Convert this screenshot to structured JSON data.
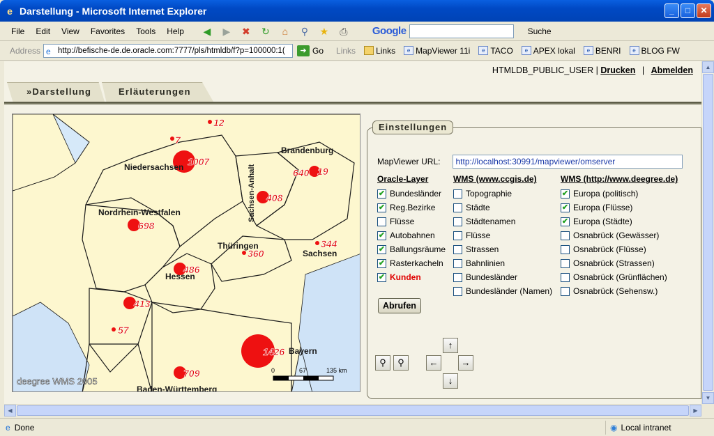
{
  "window": {
    "title": "Darstellung - Microsoft Internet Explorer"
  },
  "menu": [
    "File",
    "Edit",
    "View",
    "Favorites",
    "Tools",
    "Help"
  ],
  "google": {
    "logo": "Google",
    "search_label": "Suche"
  },
  "address": {
    "label": "Address",
    "url": "http://befische-de.de.oracle.com:7777/pls/htmldb/f?p=100000:1(",
    "go": "Go"
  },
  "links": {
    "label": "Links",
    "items": [
      "Links",
      "MapViewer 11i",
      "TACO",
      "APEX lokal",
      "BENRI",
      "BLOG FW"
    ]
  },
  "header": {
    "user": "HTMLDB_PUBLIC_USER |",
    "print": "Drucken",
    "separator": "|",
    "logout": "Abmelden"
  },
  "tabs": [
    "»Darstellung",
    "Erläuterungen"
  ],
  "map": {
    "states": [
      "Niedersachsen",
      "Brandenburg",
      "Sachsen-Anhalt",
      "Nordrhein-Westfalen",
      "Thüringen",
      "Sachsen",
      "Hessen",
      "Bayern",
      "Baden-Württemberg"
    ],
    "counts": [
      "7",
      "12",
      "1007",
      "640",
      "19",
      "408",
      "698",
      "344",
      "360",
      "486",
      "413",
      "57",
      "1426",
      "709"
    ],
    "scale": {
      "labels": [
        "0",
        "67",
        "135 km"
      ]
    },
    "watermark": "deegree WMS 2005"
  },
  "settings": {
    "legend": "Einstellungen",
    "url_label": "MapViewer URL:",
    "url_value": "http://localhost:30991/mapviewer/omserver",
    "oracle": {
      "title": "Oracle-Layer",
      "items": [
        {
          "label": "Bundesländer",
          "checked": true
        },
        {
          "label": "Reg.Bezirke",
          "checked": true
        },
        {
          "label": "Flüsse",
          "checked": false
        },
        {
          "label": "Autobahnen",
          "checked": true
        },
        {
          "label": "Ballungsräume",
          "checked": true
        },
        {
          "label": "Rasterkacheln",
          "checked": true
        },
        {
          "label": "Kunden",
          "checked": true
        }
      ]
    },
    "ccgis": {
      "title": "WMS (www.ccgis.de)",
      "items": [
        {
          "label": "Topographie",
          "checked": false
        },
        {
          "label": "Städte",
          "checked": false
        },
        {
          "label": "Städtenamen",
          "checked": false
        },
        {
          "label": "Flüsse",
          "checked": false
        },
        {
          "label": "Strassen",
          "checked": false
        },
        {
          "label": "Bahnlinien",
          "checked": false
        },
        {
          "label": "Bundesländer",
          "checked": false
        },
        {
          "label": "Bundesländer (Namen)",
          "checked": false
        }
      ]
    },
    "deegree": {
      "title": "WMS (http://www.deegree.de)",
      "items": [
        {
          "label": "Europa (politisch)",
          "checked": true
        },
        {
          "label": "Europa (Flüsse)",
          "checked": true
        },
        {
          "label": "Europa (Städte)",
          "checked": true
        },
        {
          "label": "Osnabrück (Gewässer)",
          "checked": false
        },
        {
          "label": "Osnabrück (Flüsse)",
          "checked": false
        },
        {
          "label": "Osnabrück (Strassen)",
          "checked": false
        },
        {
          "label": "Osnabrück (Grünflächen)",
          "checked": false
        },
        {
          "label": "Osnabrück (Sehensw.)",
          "checked": false
        }
      ]
    },
    "button": "Abrufen"
  },
  "status": {
    "left": "Done",
    "zone": "Local intranet"
  }
}
